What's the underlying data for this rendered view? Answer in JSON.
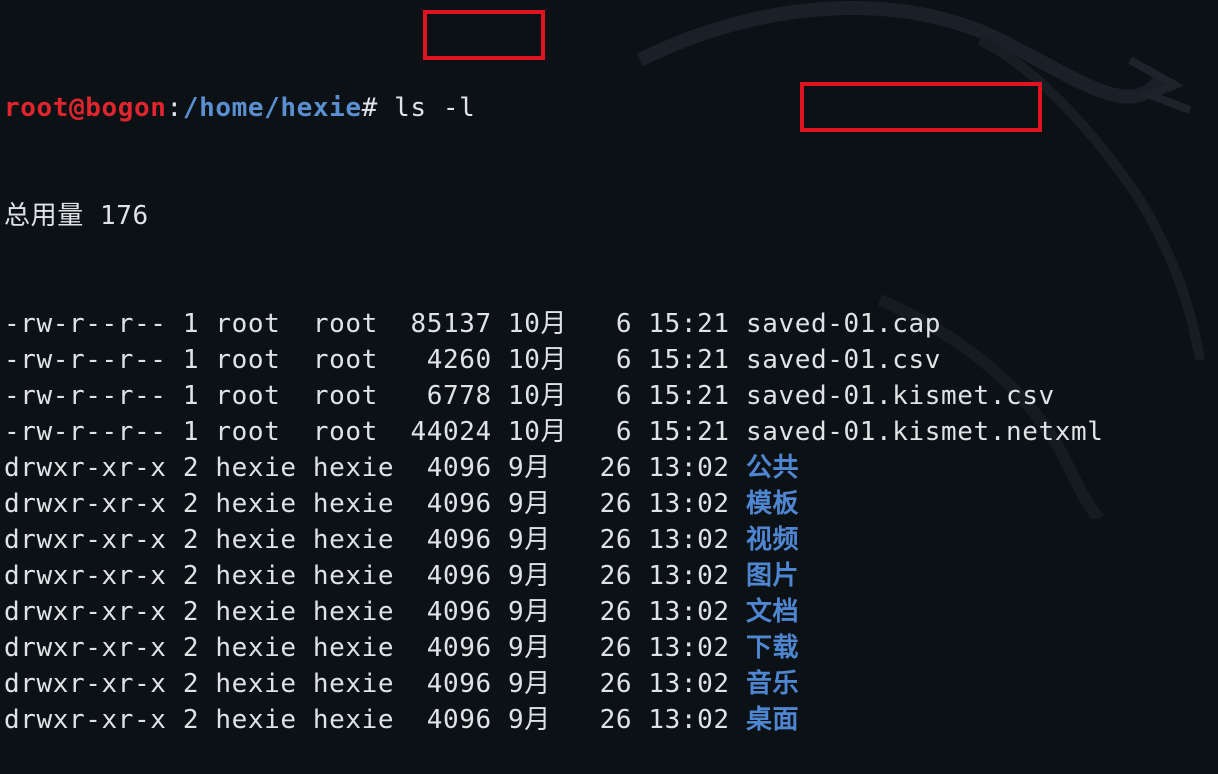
{
  "prompt": {
    "user_host": "root@bogon",
    "colon": ":",
    "path": "/home/hexie",
    "symbol": "#",
    "command": "ls -l"
  },
  "total_line": "总用量 176",
  "files": [
    {
      "perms": "-rw-r--r--",
      "links": "1",
      "owner": "root ",
      "group": "root ",
      "size": "85137",
      "month": "10月",
      "day": " 6",
      "time": "15:21",
      "name": "saved-01.cap",
      "is_dir": false
    },
    {
      "perms": "-rw-r--r--",
      "links": "1",
      "owner": "root ",
      "group": "root ",
      "size": " 4260",
      "month": "10月",
      "day": " 6",
      "time": "15:21",
      "name": "saved-01.csv",
      "is_dir": false
    },
    {
      "perms": "-rw-r--r--",
      "links": "1",
      "owner": "root ",
      "group": "root ",
      "size": " 6778",
      "month": "10月",
      "day": " 6",
      "time": "15:21",
      "name": "saved-01.kismet.csv",
      "is_dir": false
    },
    {
      "perms": "-rw-r--r--",
      "links": "1",
      "owner": "root ",
      "group": "root ",
      "size": "44024",
      "month": "10月",
      "day": " 6",
      "time": "15:21",
      "name": "saved-01.kismet.netxml",
      "is_dir": false
    },
    {
      "perms": "drwxr-xr-x",
      "links": "2",
      "owner": "hexie",
      "group": "hexie",
      "size": " 4096",
      "month": "9月 ",
      "day": "26",
      "time": "13:02",
      "name": "公共",
      "is_dir": true
    },
    {
      "perms": "drwxr-xr-x",
      "links": "2",
      "owner": "hexie",
      "group": "hexie",
      "size": " 4096",
      "month": "9月 ",
      "day": "26",
      "time": "13:02",
      "name": "模板",
      "is_dir": true
    },
    {
      "perms": "drwxr-xr-x",
      "links": "2",
      "owner": "hexie",
      "group": "hexie",
      "size": " 4096",
      "month": "9月 ",
      "day": "26",
      "time": "13:02",
      "name": "视频",
      "is_dir": true
    },
    {
      "perms": "drwxr-xr-x",
      "links": "2",
      "owner": "hexie",
      "group": "hexie",
      "size": " 4096",
      "month": "9月 ",
      "day": "26",
      "time": "13:02",
      "name": "图片",
      "is_dir": true
    },
    {
      "perms": "drwxr-xr-x",
      "links": "2",
      "owner": "hexie",
      "group": "hexie",
      "size": " 4096",
      "month": "9月 ",
      "day": "26",
      "time": "13:02",
      "name": "文档",
      "is_dir": true
    },
    {
      "perms": "drwxr-xr-x",
      "links": "2",
      "owner": "hexie",
      "group": "hexie",
      "size": " 4096",
      "month": "9月 ",
      "day": "26",
      "time": "13:02",
      "name": "下载",
      "is_dir": true
    },
    {
      "perms": "drwxr-xr-x",
      "links": "2",
      "owner": "hexie",
      "group": "hexie",
      "size": " 4096",
      "month": "9月 ",
      "day": "26",
      "time": "13:02",
      "name": "音乐",
      "is_dir": true
    },
    {
      "perms": "drwxr-xr-x",
      "links": "2",
      "owner": "hexie",
      "group": "hexie",
      "size": " 4096",
      "month": "9月 ",
      "day": "26",
      "time": "13:02",
      "name": "桌面",
      "is_dir": true
    }
  ],
  "colors": {
    "background": "#0c1116",
    "text": "#dfe3e6",
    "user": "#e0252d",
    "path": "#5a8fd0",
    "directory": "#4f86d1",
    "highlight": "#e0141e"
  }
}
